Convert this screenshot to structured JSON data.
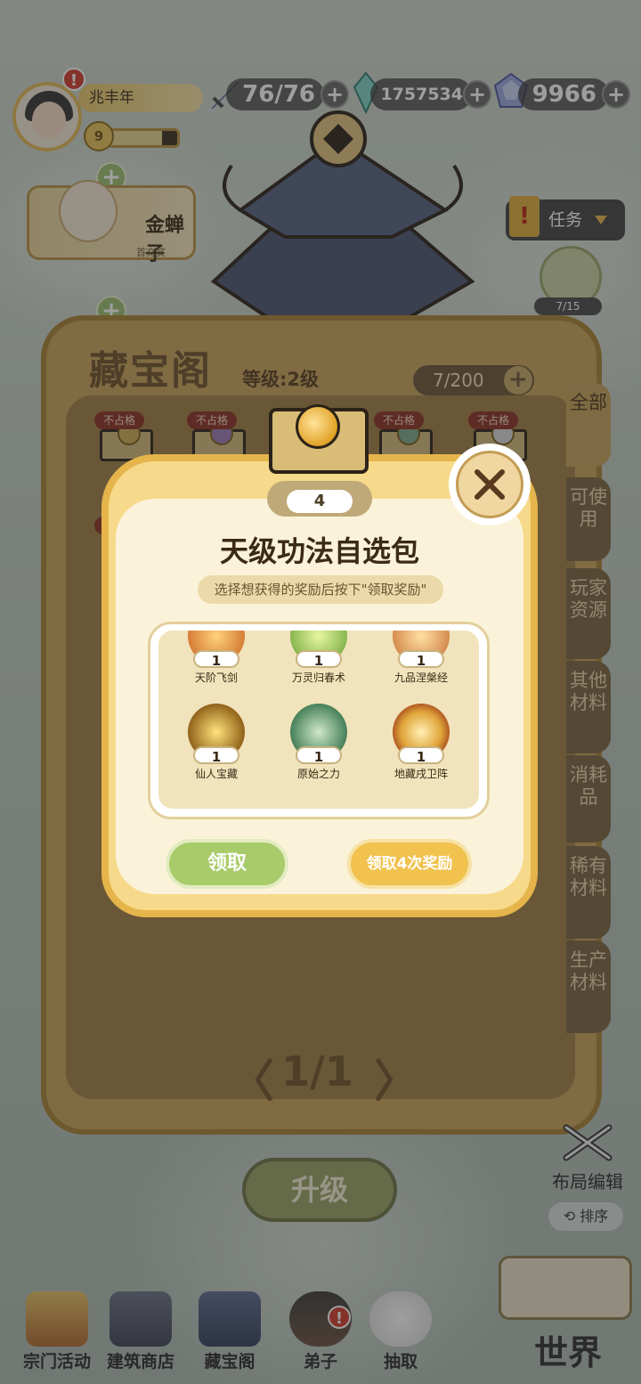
{
  "player": {
    "name": "兆丰年",
    "level": "9",
    "exp_fraction": 0.78
  },
  "resources": {
    "stamina": "76/76",
    "spirit_stones": "1757534",
    "gems": "9966",
    "plus": "+"
  },
  "side_character": {
    "name": "金蝉子",
    "sub": "首充奖"
  },
  "task": {
    "label": "任务",
    "progress": "7/15"
  },
  "pavilion": {
    "title": "藏宝阁",
    "level": "等级:2级",
    "capacity": "7/200",
    "slot_tag": "不占格",
    "pager": "1/1",
    "left_arrow": "〈",
    "right_arrow": "〉",
    "upgrade": "升级",
    "tabs": [
      "全部",
      "可使用",
      "玩家资源",
      "其他材料",
      "消耗品",
      "稀有材料",
      "生产材料"
    ]
  },
  "dialog": {
    "count": "4",
    "title": "天级功法自选包",
    "subtitle": "选择想获得的奖励后按下\"领取奖励\"",
    "items": [
      {
        "name": "天阶飞剑",
        "qty": "1"
      },
      {
        "name": "万灵归春术",
        "qty": "1"
      },
      {
        "name": "九品涅槃经",
        "qty": "1"
      },
      {
        "name": "仙人宝藏",
        "qty": "1"
      },
      {
        "name": "原始之力",
        "qty": "1"
      },
      {
        "name": "地藏戌卫阵",
        "qty": "1"
      }
    ],
    "claim": "领取",
    "claim_multi": "领取4次奖励"
  },
  "layout_edit": "布局编辑",
  "sort": "排序",
  "nav": [
    "宗门活动",
    "建筑商店",
    "藏宝阁",
    "弟子",
    "抽取"
  ],
  "world": "世界",
  "colors": {
    "accent_gold": "#e5b54c",
    "claim_green": "#a9cc6b",
    "alert_red": "#d23b2c"
  }
}
